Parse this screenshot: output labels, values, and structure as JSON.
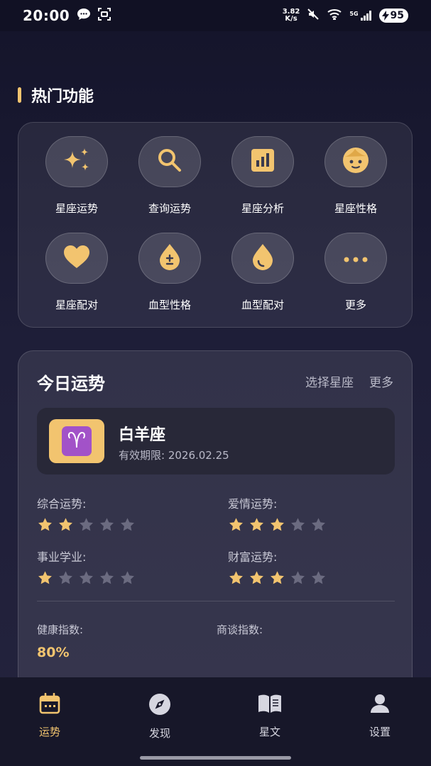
{
  "status_bar": {
    "time": "20:00",
    "net_speed_value": "3.82",
    "net_speed_unit": "K/s",
    "network_type": "5G",
    "battery": "95"
  },
  "hot_features": {
    "title": "热门功能",
    "items": [
      {
        "label": "星座运势",
        "icon": "sparkles-icon"
      },
      {
        "label": "查询运势",
        "icon": "search-icon"
      },
      {
        "label": "星座分析",
        "icon": "chart-icon"
      },
      {
        "label": "星座性格",
        "icon": "face-icon"
      },
      {
        "label": "星座配对",
        "icon": "heart-icon"
      },
      {
        "label": "血型性格",
        "icon": "blood-drop-plus-minus-icon"
      },
      {
        "label": "血型配对",
        "icon": "blood-drop-icon"
      },
      {
        "label": "更多",
        "icon": "more-icon"
      }
    ]
  },
  "today_fortune": {
    "title": "今日运势",
    "select_sign_label": "选择星座",
    "more_label": "更多",
    "sign": {
      "name": "白羊座",
      "symbol": "♈",
      "validity": "有效期限: 2026.02.25"
    },
    "ratings": [
      {
        "label": "综合运势:",
        "stars": 2,
        "max": 5
      },
      {
        "label": "爱情运势:",
        "stars": 3,
        "max": 5
      },
      {
        "label": "事业学业:",
        "stars": 1,
        "max": 5
      },
      {
        "label": "财富运势:",
        "stars": 3,
        "max": 5
      }
    ],
    "health_index_label": "健康指数:",
    "health_index_value": "80%",
    "negotiation_index_label": "商谈指数:"
  },
  "bottom_nav": {
    "items": [
      {
        "label": "运势",
        "icon": "calendar-icon",
        "active": true
      },
      {
        "label": "发现",
        "icon": "compass-icon",
        "active": false
      },
      {
        "label": "星文",
        "icon": "book-icon",
        "active": false
      },
      {
        "label": "设置",
        "icon": "user-icon",
        "active": false
      }
    ]
  },
  "colors": {
    "accent": "#f2c46f",
    "background": "#1c1c33",
    "star_filled": "#f2c46f",
    "star_empty": "#6b6b80"
  }
}
